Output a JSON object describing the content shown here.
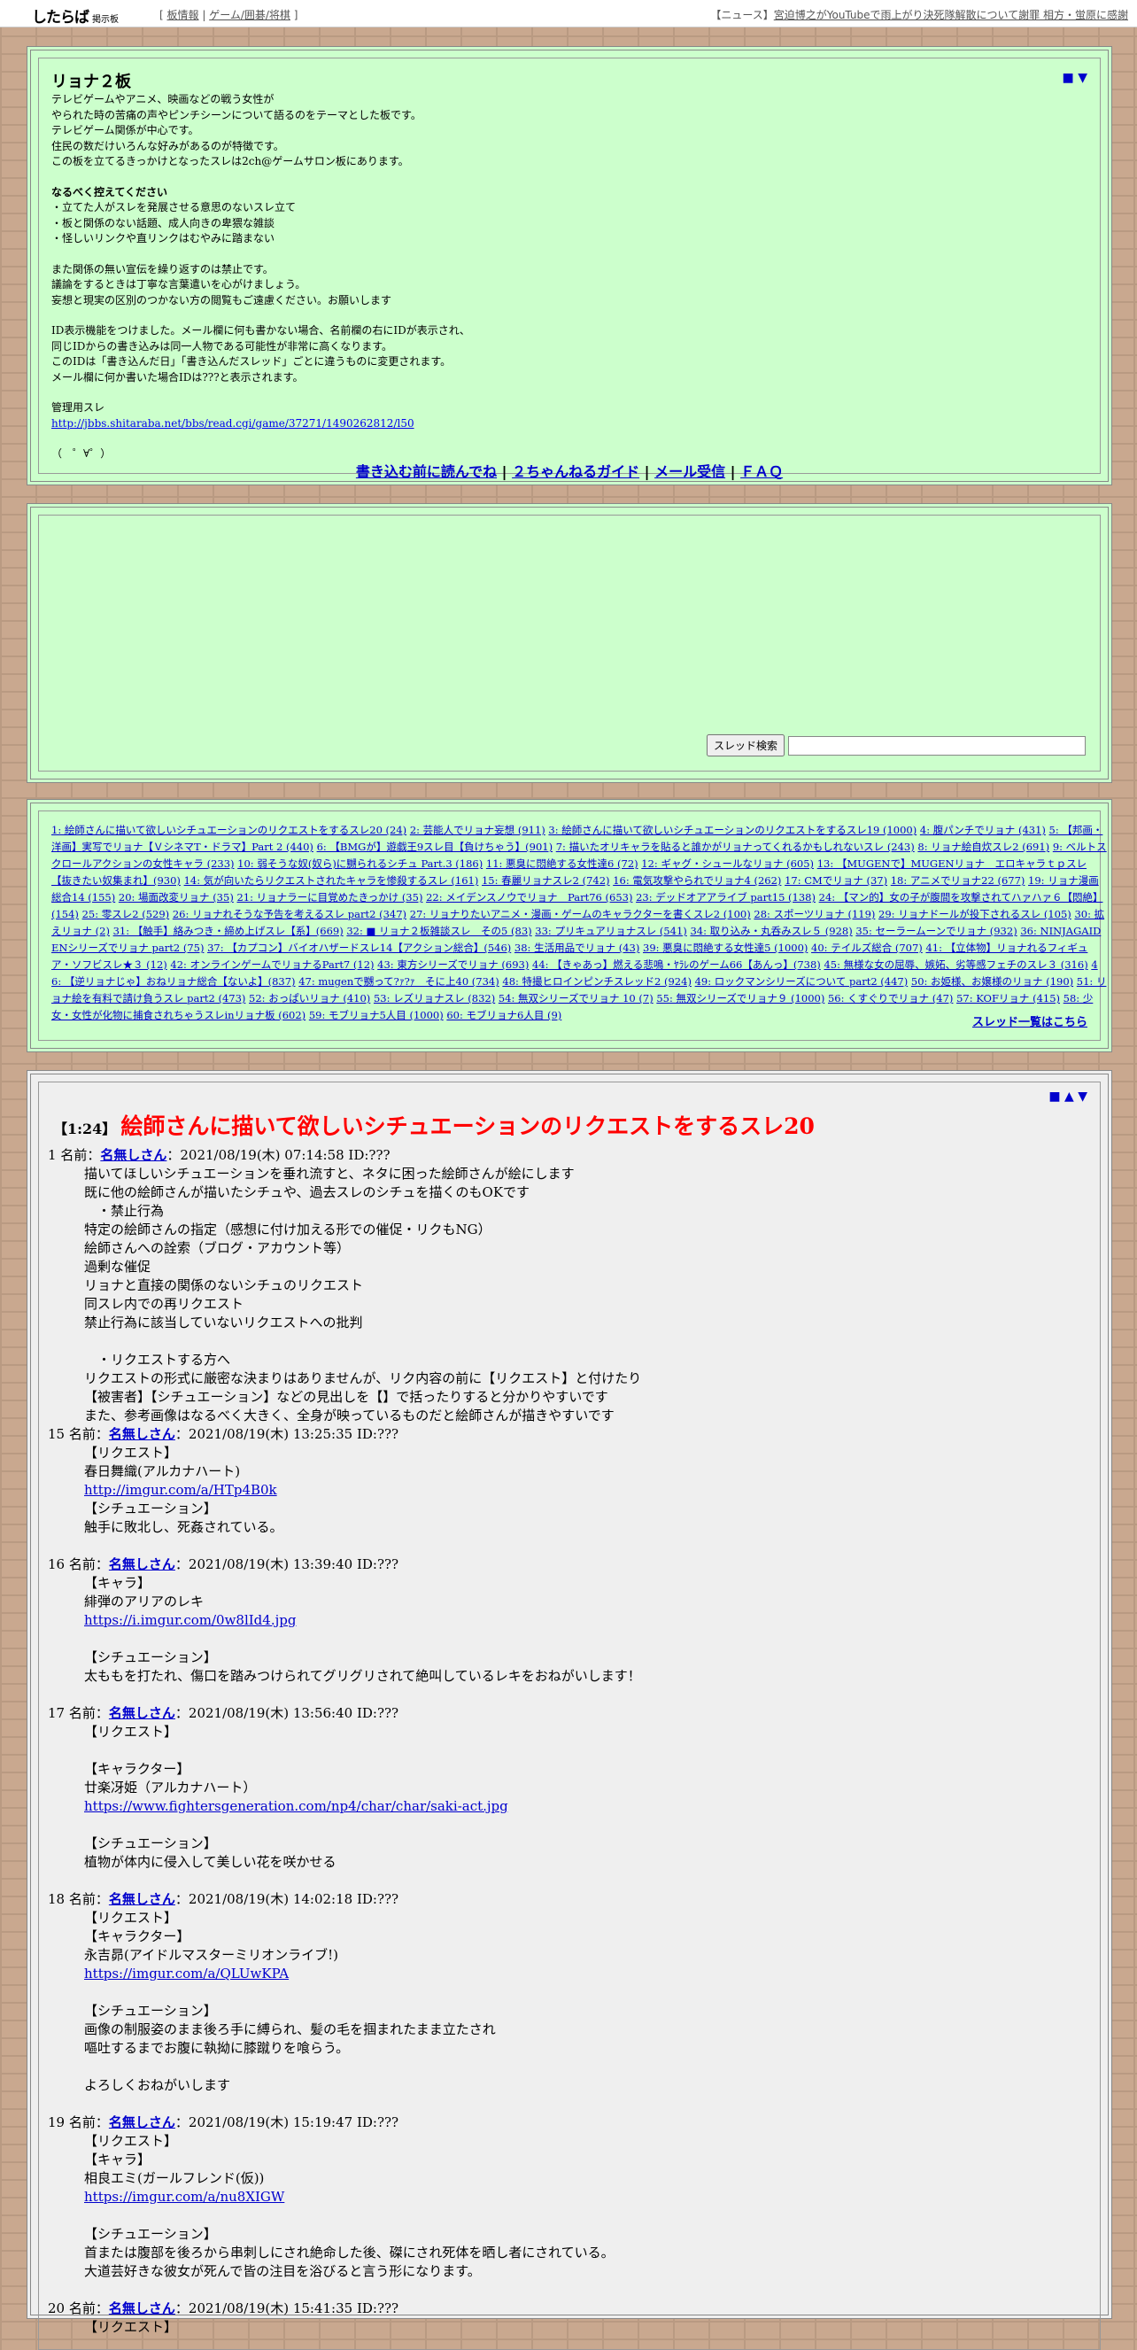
{
  "topbar": {
    "logo": "したらば",
    "logo_sub": "掲示板",
    "links": [
      "板情報",
      "ゲーム/囲碁/将棋"
    ],
    "news_label": "【ニュース】",
    "news_text": "宮迫博之がYouTubeで雨上がり決死隊解散について謝罪 相方・蛍原に感謝"
  },
  "header": {
    "nav": "■ ▼",
    "title": "リョナ２板",
    "desc_lines": [
      "テレビゲームやアニメ、映画などの戦う女性が",
      "やられた時の苦痛の声やピンチシーンについて語るのをテーマとした板です。",
      "テレビゲーム関係が中心です。",
      "住民の数だけいろんな好みがあるのが特徴です。",
      "この板を立てるきっかけとなったスレは2ch@ゲームサロン板にあります。"
    ],
    "rules_title": "なるべく控えてください",
    "rules": [
      "・立てた人がスレを発展させる意思のないスレ立て",
      "・板と関係のない話題、成人向きの卑猥な雑談",
      "・怪しいリンクや直リンクはむやみに踏まない"
    ],
    "notice": [
      "また関係の無い宣伝を繰り返すのは禁止です。",
      "議論をするときは丁寧な言葉遣いを心がけましょう。",
      "妄想と現実の区別のつかない方の閲覧もご遠慮ください。お願いします"
    ],
    "id_notes": [
      "ID表示機能をつけました。メール欄に何も書かない場合、名前欄の右にIDが表示され、",
      "同じIDからの書き込みは同一人物である可能性が非常に高くなります。",
      "このIDは「書き込んだ日」「書き込んだスレッド」ごとに違うものに変更されます。",
      "メール欄に何か書いた場合IDは???と表示されます。"
    ],
    "admin_label": "管理用スレ",
    "admin_url": "http://jbbs.shitaraba.net/bbs/read.cgi/game/37271/1490262812/l50",
    "face": "（　゜∀゜）",
    "guide": [
      "書き込む前に読んでね",
      "２ちゃんねるガイド",
      "メール受信",
      "ＦＡＱ"
    ]
  },
  "search": {
    "button": "スレッド検索",
    "placeholder": ""
  },
  "threads": {
    "items": [
      "1: 絵師さんに描いて欲しいシチュエーションのリクエストをするスレ20 (24)",
      "2: 芸能人でリョナ妄想 (911)",
      "3: 絵師さんに描いて欲しいシチュエーションのリクエストをするスレ19 (1000)",
      "4: 腹パンチでリョナ (431)",
      "5: 【邦画・洋画】実写でリョナ【ＶシネマΤ・ドラマ】Part 2 (440)",
      "6: 【BMGが】遊戯王9スレ目【負けちゃう】(901)",
      "7: 描いたオリキャラを貼ると誰かがリョナってくれるかもしれないスレ (243)",
      "8: リョナ絵自炊スレ2 (691)",
      "9: ベルトスクロールアクションの女性キャラ (233)",
      "10: 弱そうな奴(奴ら)に嬲られるシチュ Part.3 (186)",
      "11: 悪臭に悶絶する女性達6 (72)",
      "12: ギャグ・シュールなリョナ (605)",
      "13: 【MUGENで】MUGENリョナ　エロキャラｔｐスレ【抜きたい奴集まれ】(930)",
      "14: 気が向いたらリクエストされたキャラを惨殺するスレ (161)",
      "15: 春麗リョナスレ2 (742)",
      "16: 電気攻撃やられでリョナ4 (262)",
      "17: CMでリョナ (37)",
      "18: アニメでリョナ22 (677)",
      "19: リョナ漫画総合14 (155)",
      "20: 場面改変リョナ (35)",
      "21: リョナラーに目覚めたきっかけ (35)",
      "22: メイデンスノウでリョナ　Part76 (653)",
      "23: デッドオアアライブ part15 (138)",
      "24: 【マン的】女の子が腹間を攻撃されてハァハァ６【悶絶】(154)",
      "25: 零スレ2 (529)",
      "26: リョナれそうな予告を考えるスレ part2 (347)",
      "27: リョナりたいアニメ・漫画・ゲームのキャラクターを書くスレ2 (100)",
      "28: スポーツリョナ (119)",
      "29: リョナドールが投下されるスレ (105)",
      "30: 拡えリョナ (2)",
      "31: 【触手】絡みつき・締め上げスレ【系】(669)",
      "32: ■ リョナ２板雑談スレ　その5 (83)",
      "33: プリキュアリョナスレ (541)",
      "34: 取り込み・丸呑みスレ５ (928)",
      "35: セーラームーンでリョナ (932)",
      "36: NINJAGAIDENシリーズでリョナ part2 (75)",
      "37: 【カプコン】バイオハザードスレ14【アクション総合】(546)",
      "38: 生活用品でリョナ (43)",
      "39: 悪臭に悶絶する女性達5 (1000)",
      "40: テイルズ総合 (707)",
      "41: 【立体物】リョナれるフィギュア・ソフビスレ★３ (12)",
      "42: オンラインゲームでリョナるPart7 (12)",
      "43: 東方シリーズでリョナ (693)",
      "44: 【きゃあっ】燃える悲鳴・ﾔﾗﾚのゲーム66【あんっ】(738)",
      "45: 無様な女の屈辱、嫉妬、劣等感フェチのスレ３ (316)",
      "46: 【逆リョナじゃ】おねリョナ総合【ないよ】(837)",
      "47: mugenで嬲って?ｧ?ｧ　そに上40 (734)",
      "48: 特撮ヒロインピンチスレッド2 (924)",
      "49: ロックマンシリーズについて part2 (447)",
      "50: お姫様、お嬢様のリョナ (190)",
      "51: リョナ絵を有料で請け負うスレ part2 (473)",
      "52: おっぱいリョナ (410)",
      "53: レズリョナスレ (832)",
      "54: 無双シリーズでリョナ 10 (7)",
      "55: 無双シリーズでリョナ９ (1000)",
      "56: くすぐりでリョナ (47)",
      "57: KOFリョナ (415)",
      "58: 少女・女性が化物に捕食されちゃうスレinリョナ板 (602)",
      "59: モブリョナ5人目 (1000)",
      "60: モブリョナ6人目 (9)"
    ],
    "all_link": "スレッド一覧はこちら"
  },
  "thread": {
    "nav": "■ ▲ ▼",
    "num": "【1:24】",
    "title": "絵師さんに描いて欲しいシチュエーションのリクエストをするスレ20",
    "posts": [
      {
        "num": "1",
        "name_label": "名前：",
        "name": "名無しさん",
        "meta": "：2021/08/19(木) 07:14:58 ID:???",
        "lines": [
          "描いてほしいシチュエーションを垂れ流すと、ネタに困った絵師さんが絵にします",
          "既に他の絵師さんが描いたシチュや、過去スレのシチュを描くのもOKです",
          "　・禁止行為",
          "特定の絵師さんの指定（感想に付け加える形での催促・リクもNG）",
          "絵師さんへの詮索（ブログ・アカウント等）",
          "過剰な催促",
          "リョナと直接の関係のないシチュのリクエスト",
          "同スレ内での再リクエスト",
          "禁止行為に該当していないリクエストへの批判",
          "",
          "　・リクエストする方へ",
          "リクエストの形式に厳密な決まりはありませんが、リク内容の前に【リクエスト】と付けたり",
          "【被害者】【シチュエーション】などの見出しを【】で括ったりすると分かりやすいです",
          "また、参考画像はなるべく大きく、全身が映っているものだと絵師さんが描きやすいです"
        ]
      },
      {
        "num": "15",
        "name_label": "名前：",
        "name": "名無しさん",
        "meta": "：2021/08/19(木) 13:25:35 ID:???",
        "lines": [
          "【リクエスト】",
          "春日舞織(アルカナハート)",
          "@http://imgur.com/a/HTp4B0k",
          "【シチュエーション】",
          "触手に敗北し、死姦されている。",
          ""
        ]
      },
      {
        "num": "16",
        "name_label": "名前：",
        "name": "名無しさん",
        "meta": "：2021/08/19(木) 13:39:40 ID:???",
        "lines": [
          "【キャラ】",
          "緋弾のアリアのレキ",
          "@https://i.imgur.com/0w8lId4.jpg",
          "",
          "【シチュエーション】",
          "太ももを打たれ、傷口を踏みつけられてグリグリされて絶叫しているレキをおねがいします！",
          ""
        ]
      },
      {
        "num": "17",
        "name_label": "名前：",
        "name": "名無しさん",
        "meta": "：2021/08/19(木) 13:56:40 ID:???",
        "lines": [
          "【リクエスト】",
          "",
          "【キャラクター】",
          "廿楽冴姫（アルカナハート）",
          "@https://www.fightersgeneration.com/np4/char/char/saki-act.jpg",
          "",
          "【シチュエーション】",
          "植物が体内に侵入して美しい花を咲かせる",
          ""
        ]
      },
      {
        "num": "18",
        "name_label": "名前：",
        "name": "名無しさん",
        "meta": "：2021/08/19(木) 14:02:18 ID:???",
        "lines": [
          "【リクエスト】",
          "【キャラクター】",
          "永吉昴(アイドルマスターミリオンライブ!)",
          "@https://imgur.com/a/QLUwKPA",
          "",
          "【シチュエーション】",
          "画像の制服姿のまま後ろ手に縛られ、髪の毛を掴まれたまま立たされ",
          "嘔吐するまでお腹に執拗に膝蹴りを喰らう。",
          "",
          "よろしくおねがいします",
          ""
        ]
      },
      {
        "num": "19",
        "name_label": "名前：",
        "name": "名無しさん",
        "meta": "：2021/08/19(木) 15:19:47 ID:???",
        "lines": [
          "【リクエスト】",
          "【キャラ】",
          "相良エミ(ガールフレンド(仮))",
          "@https://imgur.com/a/nu8XIGW",
          "",
          "【シチュエーション】",
          "首または腹部を後ろから串刺しにされ絶命した後、磔にされ死体を晒し者にされている。",
          "大道芸好きな彼女が死んで皆の注目を浴びると言う形になります。",
          ""
        ]
      },
      {
        "num": "20",
        "name_label": "名前：",
        "name": "名無しさん",
        "meta": "：2021/08/19(木) 15:41:35 ID:???",
        "lines": [
          "【リクエスト】"
        ]
      }
    ]
  }
}
